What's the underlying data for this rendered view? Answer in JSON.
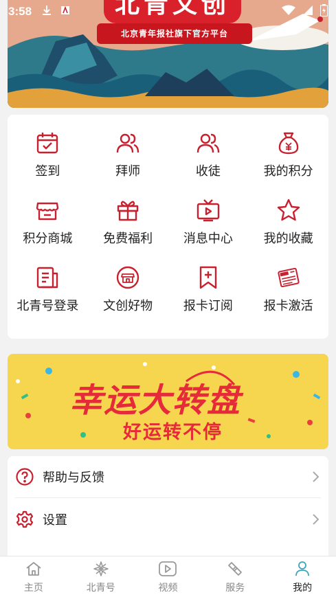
{
  "status_bar": {
    "time": "3:58"
  },
  "banner": {
    "title": "北青文创",
    "subtitle": "北京青年报社旗下官方平台"
  },
  "grid": {
    "items": [
      {
        "label": "签到",
        "icon": "calendar-check-icon"
      },
      {
        "label": "拜师",
        "icon": "users-icon"
      },
      {
        "label": "收徒",
        "icon": "users-icon"
      },
      {
        "label": "我的积分",
        "icon": "money-bag-icon"
      },
      {
        "label": "积分商城",
        "icon": "store-icon"
      },
      {
        "label": "免费福利",
        "icon": "gift-icon"
      },
      {
        "label": "消息中心",
        "icon": "tv-icon"
      },
      {
        "label": "我的收藏",
        "icon": "star-icon"
      },
      {
        "label": "北青号登录",
        "icon": "document-icon"
      },
      {
        "label": "文创好物",
        "icon": "shop-icon"
      },
      {
        "label": "报卡订阅",
        "icon": "bookmark-plus-icon"
      },
      {
        "label": "报卡激活",
        "icon": "newspaper-icon"
      }
    ]
  },
  "promo": {
    "title": "幸运大转盘",
    "subtitle": "好运转不停"
  },
  "list": {
    "help": "帮助与反馈",
    "settings": "设置"
  },
  "nav": {
    "items": [
      {
        "label": "主页",
        "icon": "home-icon"
      },
      {
        "label": "北青号",
        "icon": "flower-icon"
      },
      {
        "label": "视频",
        "icon": "play-icon"
      },
      {
        "label": "服务",
        "icon": "service-icon"
      },
      {
        "label": "我的",
        "icon": "person-icon"
      }
    ],
    "active_index": 4
  },
  "colors": {
    "accent": "#c8202f",
    "promo_bg": "#f7d64f"
  }
}
